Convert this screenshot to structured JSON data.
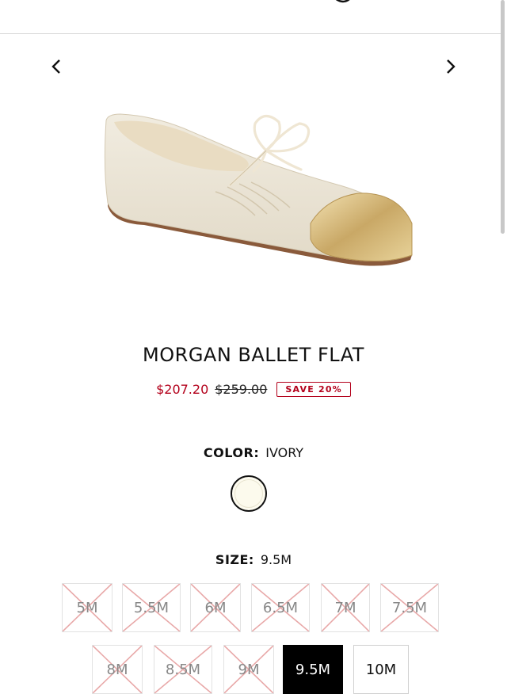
{
  "product": {
    "title": "MORGAN BALLET FLAT",
    "price_sale": "$207.20",
    "price_original": "$259.00",
    "save_badge": "SAVE 20%"
  },
  "color": {
    "label": "COLOR:",
    "value": "IVORY",
    "swatch_hex": "#fdfbef"
  },
  "size": {
    "label": "SIZE:",
    "value": "9.5M",
    "options": [
      {
        "label": "5M",
        "state": "unavailable"
      },
      {
        "label": "5.5M",
        "state": "unavailable"
      },
      {
        "label": "6M",
        "state": "unavailable"
      },
      {
        "label": "6.5M",
        "state": "unavailable"
      },
      {
        "label": "7M",
        "state": "unavailable"
      },
      {
        "label": "7.5M",
        "state": "unavailable"
      },
      {
        "label": "8M",
        "state": "unavailable"
      },
      {
        "label": "8.5M",
        "state": "unavailable"
      },
      {
        "label": "9M",
        "state": "unavailable"
      },
      {
        "label": "9.5M",
        "state": "selected"
      },
      {
        "label": "10M",
        "state": "available"
      }
    ]
  },
  "icons": {
    "prev": "chevron-left-icon",
    "next": "chevron-right-icon"
  },
  "colors": {
    "sale_red": "#b3001b",
    "cross_red": "#e8a8a8",
    "selected_bg": "#000000"
  }
}
